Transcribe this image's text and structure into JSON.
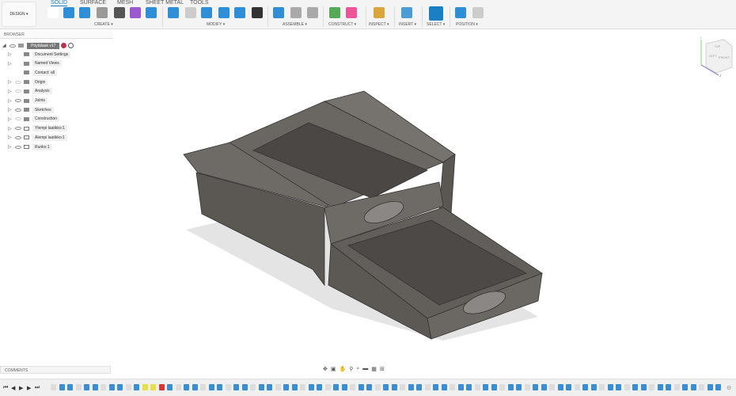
{
  "toolbar": {
    "workspace": "DESIGN ▾",
    "tabs": [
      {
        "label": "SOLID",
        "active": true
      },
      {
        "label": "SURFACE"
      },
      {
        "label": "MESH"
      },
      {
        "label": "SHEET METAL"
      },
      {
        "label": "TOOLS"
      }
    ],
    "groups": [
      "CREATE ▾",
      "MODIFY ▾",
      "ASSEMBLE ▾",
      "CONSTRUCT ▾",
      "INSPECT ▾",
      "INSERT ▾",
      "SELECT ▾",
      "POSITION ▾"
    ],
    "accent": "#1b7fc4"
  },
  "browser": {
    "title": "BROWSER",
    "root": "Pöytälaak v17",
    "items": [
      {
        "label": "Document Settings",
        "icon": "gear-icon",
        "eye": null
      },
      {
        "label": "Named Views",
        "icon": "folder-icon",
        "eye": null
      },
      {
        "label": "Contact: all",
        "icon": "contact-icon",
        "eye": null,
        "noexpand": true
      },
      {
        "label": "Origin",
        "icon": "folder-icon",
        "eye": "off"
      },
      {
        "label": "Analysis",
        "icon": "folder-icon",
        "eye": "off"
      },
      {
        "label": "Joints",
        "icon": "folder-icon",
        "eye": "on"
      },
      {
        "label": "Sketches",
        "icon": "folder-icon",
        "eye": "on"
      },
      {
        "label": "Construction",
        "icon": "folder-icon",
        "eye": "off"
      },
      {
        "label": "Ylempi laatikko:1",
        "icon": "component-icon",
        "eye": "on"
      },
      {
        "label": "Alempi laatikko:1",
        "icon": "component-icon",
        "eye": "on"
      },
      {
        "label": "Runko:1",
        "icon": "component-icon",
        "eye": "on"
      }
    ]
  },
  "viewcube": {
    "top": "TOP",
    "left": "LEFT",
    "front": "FRONT",
    "axes": [
      "Y",
      "Z"
    ]
  },
  "comments": {
    "title": "COMMENTS"
  }
}
